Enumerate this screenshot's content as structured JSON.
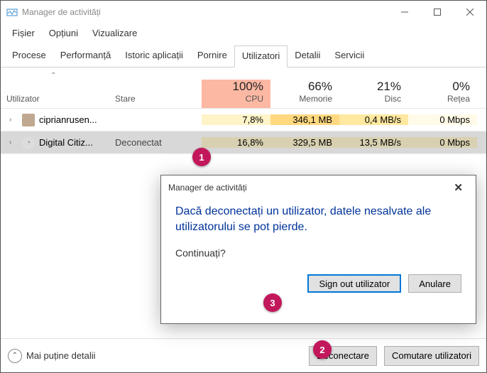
{
  "window": {
    "title": "Manager de activități"
  },
  "menu": {
    "file": "Fișier",
    "options": "Opțiuni",
    "view": "Vizualizare"
  },
  "tabs": {
    "processes": "Procese",
    "performance": "Performanță",
    "history": "Istoric aplicații",
    "startup": "Pornire",
    "users": "Utilizatori",
    "details": "Detalii",
    "services": "Servicii"
  },
  "columns": {
    "user": "Utilizator",
    "status": "Stare",
    "cpu_pct": "100%",
    "cpu_lbl": "CPU",
    "mem_pct": "66%",
    "mem_lbl": "Memorie",
    "disk_pct": "21%",
    "disk_lbl": "Disc",
    "net_pct": "0%",
    "net_lbl": "Rețea"
  },
  "rows": [
    {
      "name": "ciprianrusen...",
      "status": "",
      "cpu": "7,8%",
      "mem": "346,1 MB",
      "disk": "0,4 MB/s",
      "net": "0 Mbps"
    },
    {
      "name": "Digital Citiz...",
      "status": "Deconectat",
      "cpu": "16,8%",
      "mem": "329,5 MB",
      "disk": "13,5 MB/s",
      "net": "0 Mbps"
    }
  ],
  "footer": {
    "fewer": "Mai puține detalii",
    "disconnect": "Deconectare",
    "switch": "Comutare utilizatori"
  },
  "dialog": {
    "title": "Manager de activități",
    "message": "Dacă deconectați un utilizator, datele nesalvate ale utilizatorului se pot pierde.",
    "question": "Continuați?",
    "signout": "Sign out utilizator",
    "cancel": "Anulare"
  },
  "badges": {
    "one": "1",
    "two": "2",
    "three": "3"
  }
}
